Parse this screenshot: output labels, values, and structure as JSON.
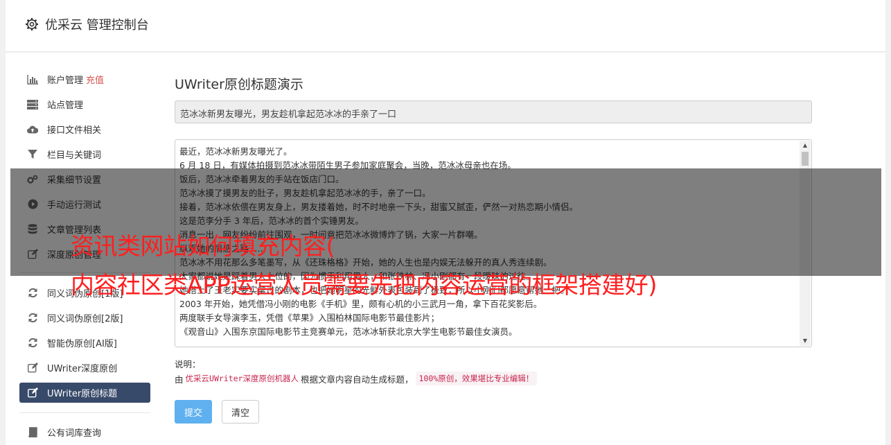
{
  "header": {
    "title": "优采云 管理控制台",
    "icon": "gear-icon"
  },
  "sidebar": {
    "items": [
      {
        "label": "账户管理",
        "extra": "充值",
        "icon": "bar-chart-icon"
      },
      {
        "label": "站点管理",
        "icon": "server-icon"
      },
      {
        "label": "接口文件相关",
        "icon": "cloud-upload-icon"
      },
      {
        "label": "栏目与关键词",
        "icon": "filter-icon"
      },
      {
        "label": "采集细节设置",
        "icon": "gears-icon"
      },
      {
        "label": "手动运行测试",
        "icon": "play-circle-icon"
      },
      {
        "label": "文章管理列表",
        "icon": "database-icon"
      },
      {
        "label": "深度原创管理",
        "icon": "edit-icon"
      },
      {
        "label": "同义词伪原创[1版]",
        "icon": "refresh-icon"
      },
      {
        "label": "同义词伪原创[2版]",
        "icon": "refresh-icon"
      },
      {
        "label": "智能伪原创[AI版]",
        "icon": "refresh-icon"
      },
      {
        "label": "UWriter深度原创",
        "icon": "edit-icon"
      },
      {
        "label": "UWriter原创标题",
        "icon": "edit-icon",
        "active": true
      },
      {
        "label": "公有词库查询",
        "icon": "book-icon"
      }
    ]
  },
  "main": {
    "heading": "UWriter原创标题演示",
    "title_value": "范冰冰新男友曝光，男友趁机拿起范冰冰的手亲了一口",
    "article_lines": [
      "最近，范冰冰新男友曝光了。",
      "6 月 18 日，有媒体拍摄到范冰冰带陌生男子参加家庭聚会，当晚，范冰冰母亲也在场。",
      "饭后，范冰冰牵着男友的手站在饭店门口。",
      "范冰冰摸了摸男友的肚子，男友趁机拿起范冰冰的手，亲了一口。",
      "接着，范冰冰依偎在男友身上，男友搂着她，时不时地亲一下头，甜蜜又腻歪，俨然一对热恋期小情侣。",
      "这是范李分手 3 年后，范冰冰的首个实锤男友。",
      "消息一出，网友纷纷前往围观，一时间竟把范冰冰微博炸了锅，大家一片群嘲。",
      "纵观她的情感之路……",
      "范冰冰不用花那么多笔墨写，从《还珠格格》开始，她的人生也是内娱无法躲开的真人秀连续剧。",
      "大家都说她是踩着男人上位的，因为惯于利用男人，和张铁林、冯小刚都有一段暧昧的过往。",
      "她搭上了王老实要实拿过的剧本，也把她明星的光鲜外表包装到了极致，所以小刚们都愿意帮她一把。",
      "2003 年开始，她凭借冯小刚的电影《手机》里，颇有心机的小三武月一角，拿下百花奖影后。",
      "两度联手女导演李玉，凭借《苹果》入围柏林国际电影节最佳影片；",
      "《观音山》入围东京国际电影节主竞赛单元，范冰冰斩获北京大学生电影节最佳女演员。"
    ],
    "note_label": "说明：",
    "note_prefix": "由",
    "note_code1": "优采云UWriter深度原创机器人",
    "note_middle": "根据文章内容自动生成标题，",
    "note_code2": "100%原创，效果堪比专业编辑！",
    "submit_label": "提交",
    "clear_label": "清空"
  },
  "overlay": {
    "line1": "资讯类网站如何填充内容(",
    "line2": "内容社区类APP运营人员需要先把内容运营的框架搭建好)"
  }
}
